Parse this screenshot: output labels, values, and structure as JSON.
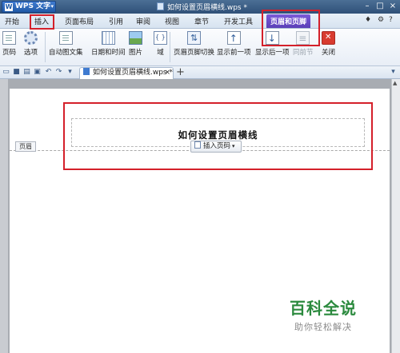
{
  "app": {
    "name": "WPS 文字",
    "document_title": "如何设置页眉横线.wps *"
  },
  "menu_tabs": [
    "开始",
    "插入",
    "页面布局",
    "引用",
    "审阅",
    "视图",
    "章节",
    "开发工具",
    "页眉和页脚"
  ],
  "menu_active": "页眉和页脚",
  "ribbon": {
    "buttons": [
      "页码",
      "选项",
      "自动图文集",
      "日期和时间",
      "图片",
      "域",
      "页眉页脚切换",
      "显示前一项",
      "显示后一项",
      "同前节",
      "关闭"
    ]
  },
  "doc_tab": {
    "label": "如何设置页眉横线.wps *",
    "new_tab": "+"
  },
  "document": {
    "header_text": "如何设置页眉横线",
    "header_label": "页眉",
    "insert_page_button": "插入页码"
  },
  "watermark": {
    "title": "百科全说",
    "subtitle": "助你轻松解决"
  },
  "colors": {
    "highlight": "#d4202a",
    "active_tab": "#5a3fb8",
    "title_bar": "#2f5078",
    "watermark": "#2b8a3e"
  }
}
